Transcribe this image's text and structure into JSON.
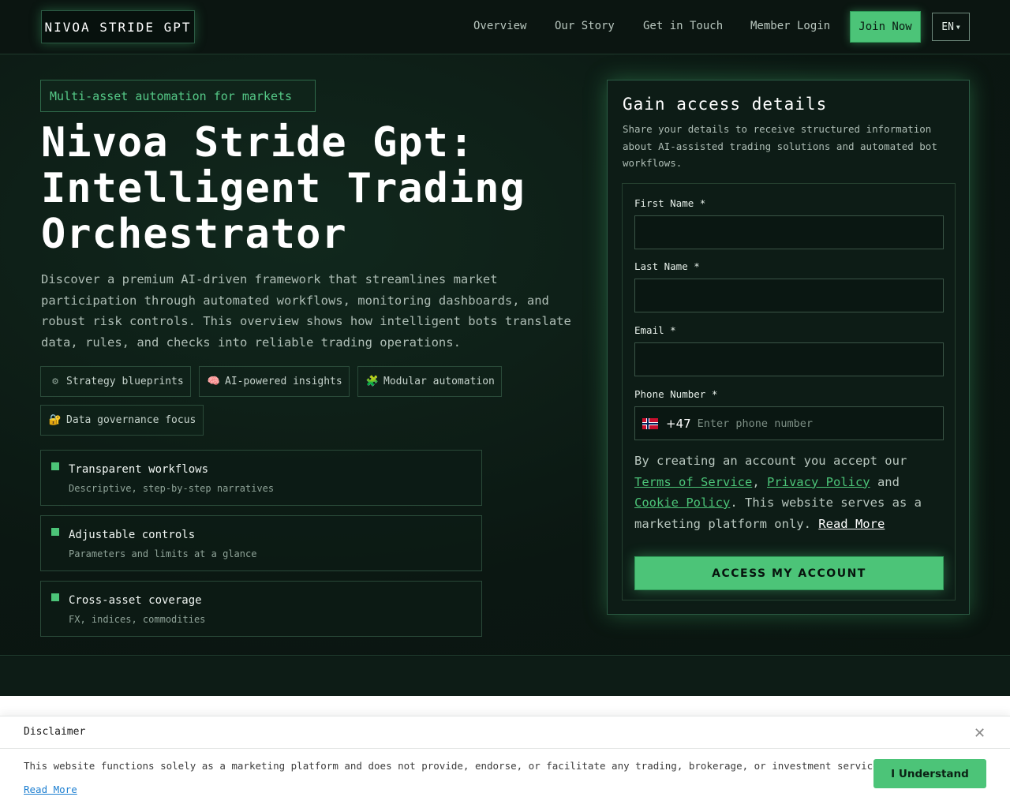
{
  "header": {
    "logo": "NIVOA STRIDE GPT",
    "nav": [
      "Overview",
      "Our Story",
      "Get in Touch",
      "Member Login"
    ],
    "join_label": "Join Now",
    "lang": "EN"
  },
  "hero": {
    "tagline": "Multi-asset automation for markets",
    "title_lines": [
      "Nivoa Stride Gpt:",
      "Intelligent Trading",
      "Orchestrator"
    ],
    "description": "Discover a premium AI-driven framework that streamlines market participation through automated workflows, monitoring dashboards, and robust risk controls. This overview shows how intelligent bots translate data, rules, and checks into reliable trading operations.",
    "chips": [
      {
        "icon": "gear-icon",
        "glyph": "⚙",
        "label": "Strategy blueprints"
      },
      {
        "icon": "brain-icon",
        "glyph": "🧠",
        "label": "AI-powered insights"
      },
      {
        "icon": "puzzle-icon",
        "glyph": "🧩",
        "label": "Modular automation"
      },
      {
        "icon": "lock-icon",
        "glyph": "🔐",
        "label": "Data governance focus"
      }
    ],
    "features": [
      {
        "title": "Transparent workflows",
        "subtitle": "Descriptive, step-by-step narratives"
      },
      {
        "title": "Adjustable controls",
        "subtitle": "Parameters and limits at a glance"
      },
      {
        "title": "Cross-asset coverage",
        "subtitle": "FX, indices, commodities"
      }
    ]
  },
  "form": {
    "title": "Gain access details",
    "subtitle": "Share your details to receive structured information about AI-assisted trading solutions and automated bot workflows.",
    "first_name_label": "First Name *",
    "last_name_label": "Last Name *",
    "email_label": "Email *",
    "phone_label": "Phone Number *",
    "dial_code": "+47",
    "phone_placeholder": "Enter phone number",
    "consent_prefix": "By creating an account you accept our ",
    "terms": "Terms of Service",
    "comma": ", ",
    "privacy": "Privacy Policy",
    "and": " and ",
    "cookie": "Cookie Policy",
    "consent_suffix": ". This website serves as a marketing platform only. ",
    "read_more": "Read More",
    "submit": "ACCESS MY ACCOUNT"
  },
  "disclaimer": {
    "title": "Disclaimer",
    "text": "This website functions solely as a marketing platform and does not provide, endorse, or facilitate any trading, brokerage, or investment services.",
    "read_more": "Read More",
    "button": "I Understand"
  }
}
